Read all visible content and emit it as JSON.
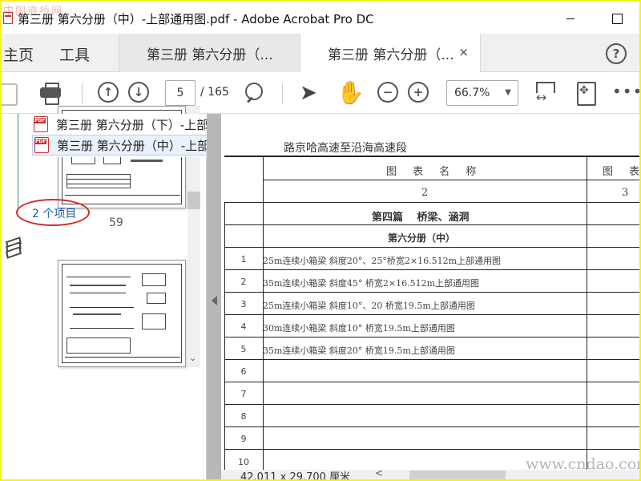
{
  "window": {
    "title": "第三册 第六分册（中）-上部通用图.pdf - Adobe Acrobat Pro DC",
    "watermark_top": "中国道桥网"
  },
  "nav": {
    "home": "主页",
    "tools": "工具"
  },
  "tabs": [
    {
      "label": "第三册 第六分册（..."
    },
    {
      "label": "第三册 第六分册（...",
      "close": "×"
    }
  ],
  "toolbar": {
    "current_page": "5",
    "total_pages": "/ 165",
    "zoom": "66.7%",
    "more": "•••",
    "help": "?",
    "up": "↑",
    "down": "↓",
    "zoom_out": "−",
    "zoom_in": "+"
  },
  "search_results": {
    "items": [
      {
        "label": "第三册 第六分册（下）-上部通用图.pdf"
      },
      {
        "label": "第三册 第六分册（中）-上部通用图.pdf"
      }
    ],
    "count": "2 个项目"
  },
  "thumbnails": [
    {
      "label": "59"
    }
  ],
  "document": {
    "heading": "路京哈高速至沿海高速段",
    "col_title": "图 表 名 称",
    "col_fig": "图 表",
    "col2_num": "2",
    "col3_num": "3",
    "section": "第四篇　 桥梁、涵洞",
    "subsection": "第六分册（中）",
    "rows": [
      {
        "no": "1",
        "text": "25m连续小箱梁 斜度20°、25°桥宽2×16.512m上部通用图"
      },
      {
        "no": "2",
        "text": "35m连续小箱梁 斜度45° 桥宽2×16.512m上部通用图"
      },
      {
        "no": "3",
        "text": "25m连续小箱梁 斜度10°、20 桥宽19.5m上部通用图"
      },
      {
        "no": "4",
        "text": "30m连续小箱梁 斜度10°  桥宽19.5m上部通用图"
      },
      {
        "no": "5",
        "text": "35m连续小箱梁 斜度20°  桥宽19.5m上部通用图"
      },
      {
        "no": "6",
        "text": ""
      },
      {
        "no": "7",
        "text": ""
      },
      {
        "no": "8",
        "text": ""
      },
      {
        "no": "9",
        "text": ""
      },
      {
        "no": "10",
        "text": ""
      }
    ]
  },
  "status": {
    "page_size": "42.011 x 29.700 厘米",
    "scroll_left": "<"
  },
  "watermark_bottom": "www.cndao.com",
  "colors": {
    "accent": "#1a6fc9",
    "annotation_ring": "#d62828",
    "screenshot_border": "#f7f21a"
  }
}
